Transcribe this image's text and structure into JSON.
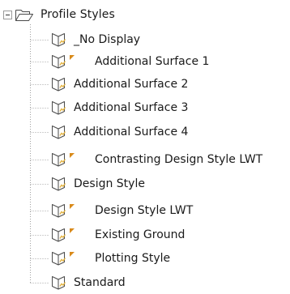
{
  "root": {
    "label": "Profile Styles",
    "expanded": true,
    "expander_icon": "collapse-minus-icon",
    "icon": "folder-open-icon"
  },
  "items": [
    {
      "label": "_No Display",
      "flag": false
    },
    {
      "label": "Additional Surface 1",
      "flag": true
    },
    {
      "label": "Additional Surface 2",
      "flag": false
    },
    {
      "label": "Additional Surface 3",
      "flag": false
    },
    {
      "label": "Additional Surface 4",
      "flag": false
    },
    {
      "label": "Contrasting Design Style LWT",
      "flag": true
    },
    {
      "label": "Design Style",
      "flag": false
    },
    {
      "label": "Design Style LWT",
      "flag": true
    },
    {
      "label": "Existing Ground",
      "flag": true
    },
    {
      "label": "Plotting Style",
      "flag": true
    },
    {
      "label": "Standard",
      "flag": false
    }
  ],
  "colors": {
    "icon_stroke": "#4a4a4a",
    "icon_accent": "#e2b13c",
    "flag": "#d98a1a",
    "tree_line": "#a0a0a0"
  }
}
